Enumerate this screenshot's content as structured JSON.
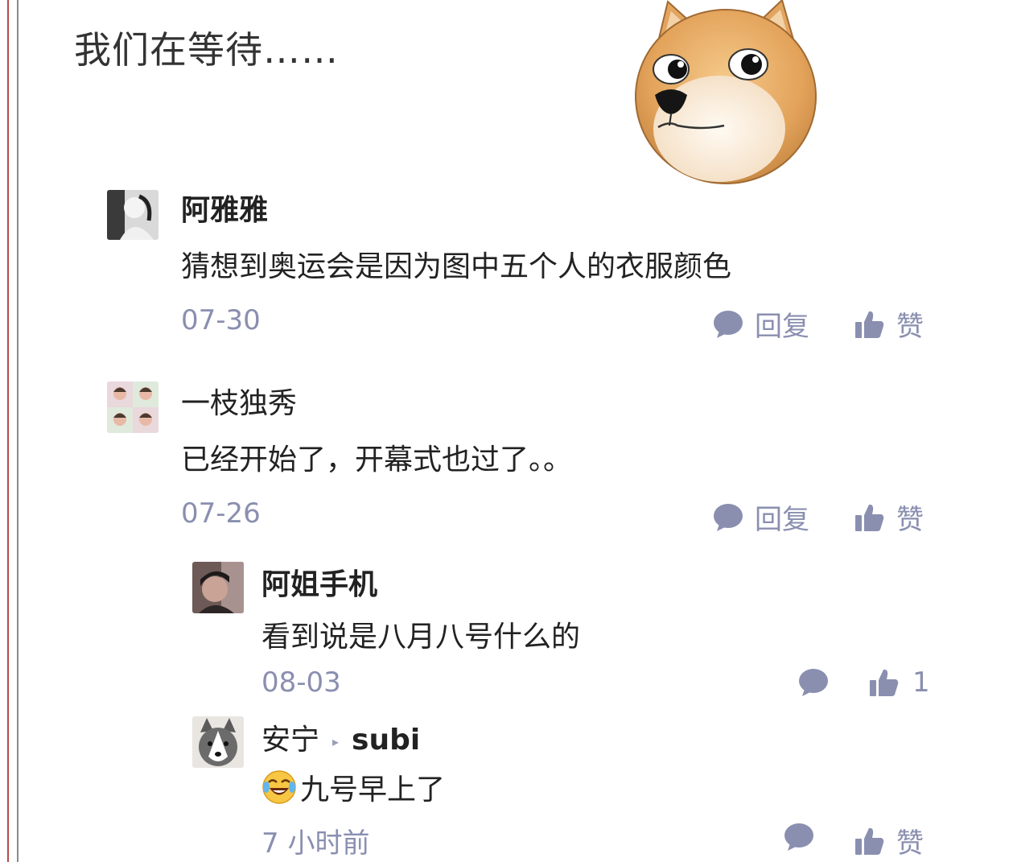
{
  "caption": "我们在等待……",
  "colors": {
    "meta": "#8a8fb0",
    "text": "#222222"
  },
  "icons": {
    "reply": "speech-bubble-icon",
    "like": "thumbs-up-icon",
    "emoji": "laughing-crying-emoji"
  },
  "comments": [
    {
      "author": "阿雅雅",
      "text": "猜想到奥运会是因为图中五个人的衣服颜色",
      "date": "07-30",
      "reply_label": "回复",
      "like_label": "赞"
    },
    {
      "author": "一枝独秀",
      "text": "已经开始了，开幕式也过了。。",
      "date": "07-26",
      "reply_label": "回复",
      "like_label": "赞",
      "replies": [
        {
          "author": "阿姐手机",
          "text": "看到说是八月八号什么的",
          "date": "08-03",
          "like_count": "1"
        },
        {
          "author": "安宁",
          "reply_to": "subi",
          "text": "九号早上了",
          "date": "7 小时前",
          "like_label": "赞"
        }
      ]
    }
  ]
}
